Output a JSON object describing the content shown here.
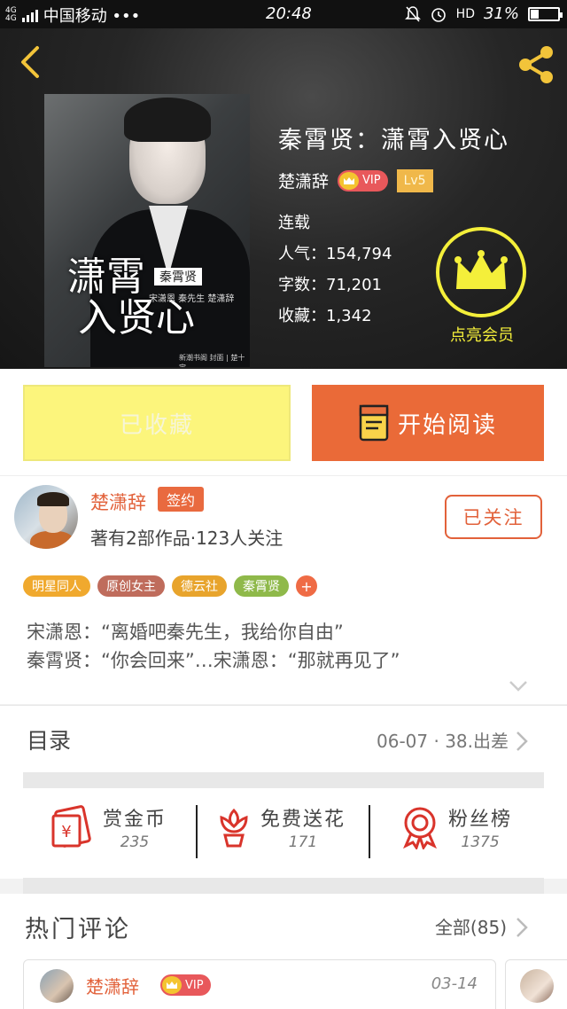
{
  "status_bar": {
    "network": "4G 4G",
    "carrier": "中国移动 •••",
    "time": "20:48",
    "hd": "HD",
    "battery": "31%",
    "battery_level": 0.31
  },
  "book": {
    "title": "秦霄贤：潇霄入贤心",
    "author": "楚潇辞",
    "vip_label": "VIP",
    "level": "Lv5",
    "status": "连载",
    "popularity": "人气：154,794",
    "word_count": "字数：71,201",
    "favorites": "收藏：1,342",
    "vip_member_label": "点亮会员",
    "cover": {
      "title_line1": "潇霄",
      "title_line2": "入贤心",
      "tag": "秦霄贤",
      "subtitle": "宋潇恩  秦先生   楚潇辞",
      "credit": "新潮书阁  封面 | 楚十宝"
    }
  },
  "actions": {
    "favorited_label": "已收藏",
    "read_label": "开始阅读"
  },
  "author": {
    "name": "楚潇辞",
    "signed_badge": "签约",
    "stats": "著有2部作品·123人关注",
    "follow_label": "已关注"
  },
  "tags": [
    {
      "label": "明星同人",
      "color": "#f0a92e"
    },
    {
      "label": "原创女主",
      "color": "#bf6c5c"
    },
    {
      "label": "德云社",
      "color": "#e8a42c"
    },
    {
      "label": "秦霄贤",
      "color": "#8fb94a"
    }
  ],
  "tag_more": "+",
  "intro": {
    "line1": "宋潇恩：“离婚吧秦先生，我给你自由”",
    "line2": "秦霄贤：“你会回来”…宋潇恩：“那就再见了”"
  },
  "catalog": {
    "title": "目录",
    "latest": "06-07 · 38.出差"
  },
  "stats": [
    {
      "label": "赏金币",
      "value": "235",
      "icon": "red-envelope-icon"
    },
    {
      "label": "免费送花",
      "value": "171",
      "icon": "flower-icon"
    },
    {
      "label": "粉丝榜",
      "value": "1375",
      "icon": "medal-icon"
    }
  ],
  "comments": {
    "title": "热门评论",
    "all_label": "全部(85)",
    "items": [
      {
        "name": "楚潇辞",
        "vip": "VIP",
        "date": "03-14"
      }
    ]
  },
  "colors": {
    "accent": "#ea6a38",
    "vip_yellow": "#f4ef3a",
    "favorite_bg": "#fcf57c"
  }
}
